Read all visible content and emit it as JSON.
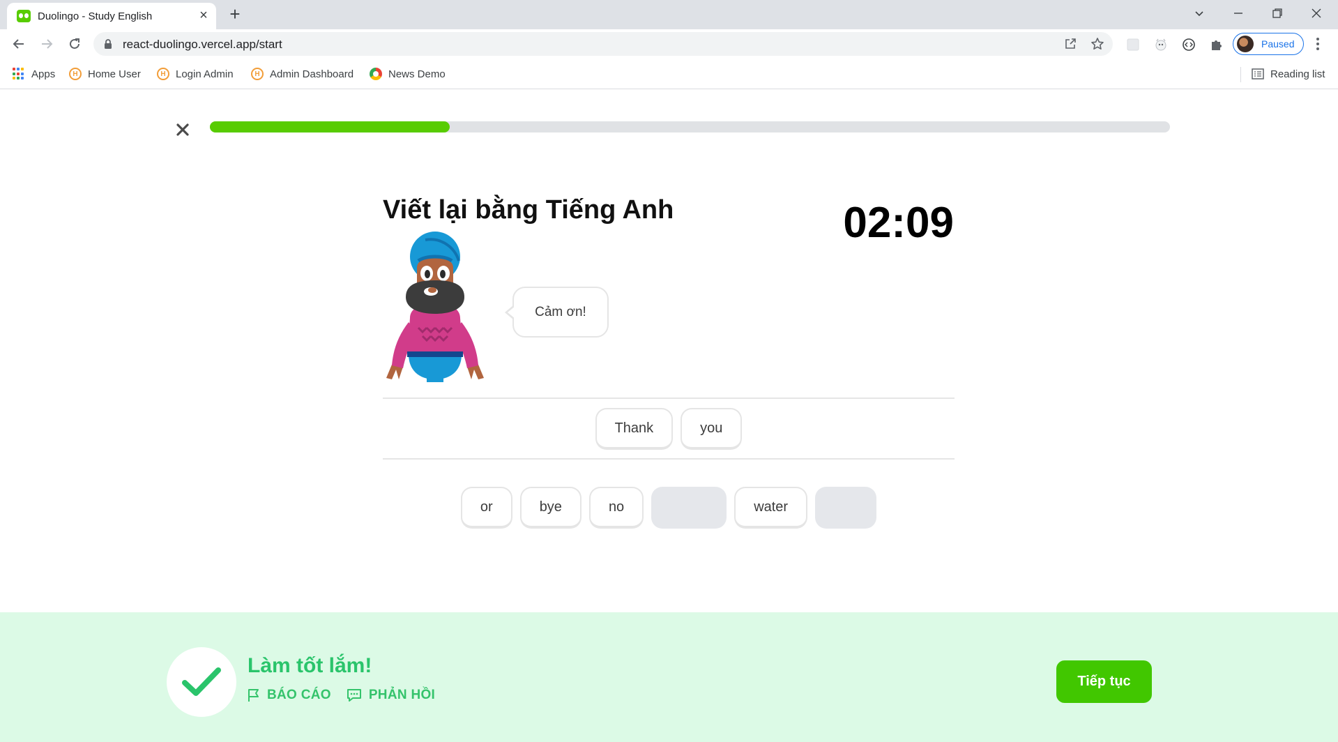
{
  "browser": {
    "tab_title": "Duolingo - Study English",
    "url": "react-duolingo.vercel.app/start",
    "profile_label": "Paused",
    "bookmarks": [
      {
        "label": "Apps",
        "icon": "apps-grid-icon"
      },
      {
        "label": "Home User",
        "icon": "h-favicon-icon"
      },
      {
        "label": "Login Admin",
        "icon": "h-favicon-icon"
      },
      {
        "label": "Admin Dashboard",
        "icon": "h-favicon-icon"
      },
      {
        "label": "News Demo",
        "icon": "news-favicon-icon"
      }
    ],
    "reading_list": "Reading list"
  },
  "lesson": {
    "progress": 0.25,
    "prompt": "Viết lại bằng Tiếng Anh",
    "timer": "02:09",
    "speech_bubble": "Cảm ơn!",
    "answer_tiles": [
      "Thank",
      "you"
    ],
    "word_bank": [
      {
        "label": "or",
        "used": false
      },
      {
        "label": "bye",
        "used": false
      },
      {
        "label": "no",
        "used": false
      },
      {
        "label": "",
        "used": true
      },
      {
        "label": "water",
        "used": false
      },
      {
        "label": "",
        "used": true
      }
    ]
  },
  "feedback": {
    "title": "Làm tốt lắm!",
    "report_label": "BÁO CÁO",
    "comment_label": "PHẢN HỒI",
    "continue_label": "Tiếp tục"
  },
  "colors": {
    "brand_green": "#58cc02",
    "footer_bg": "#dcfae6",
    "feedback_green": "#2ac46b",
    "continue_button": "#41c700",
    "profile_blue": "#1a73e8"
  }
}
